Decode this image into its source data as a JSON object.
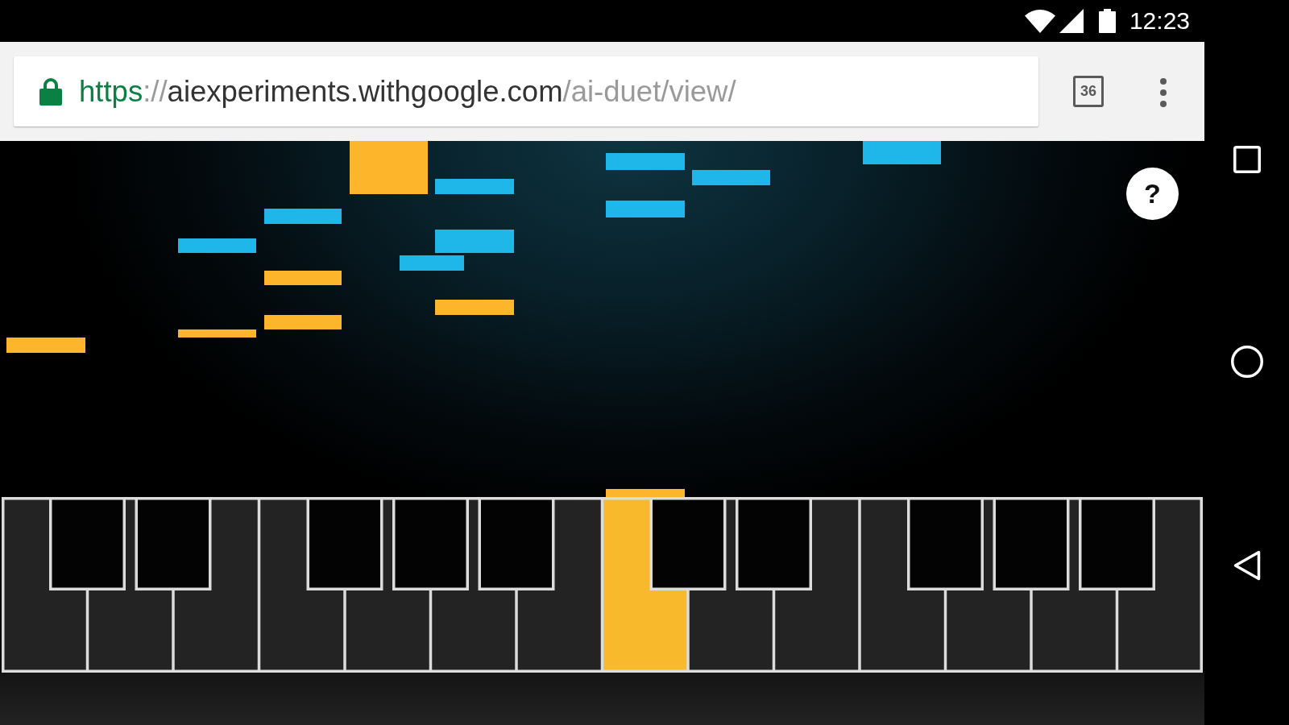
{
  "status_bar": {
    "time": "12:23"
  },
  "toolbar": {
    "url": {
      "scheme": "https",
      "separator": "://",
      "host": "aiexperiments.withgoogle.com",
      "path": "/ai-duet/view/"
    },
    "tab_count": "36"
  },
  "help_button": {
    "label": "?"
  },
  "keyboard": {
    "keys": [
      {
        "kind": "white",
        "pressed": false
      },
      {
        "kind": "black",
        "pressed": false
      },
      {
        "kind": "white",
        "pressed": false
      },
      {
        "kind": "black",
        "pressed": false
      },
      {
        "kind": "white",
        "pressed": false
      },
      {
        "kind": "white",
        "pressed": false
      },
      {
        "kind": "black",
        "pressed": false
      },
      {
        "kind": "white",
        "pressed": false
      },
      {
        "kind": "black",
        "pressed": false
      },
      {
        "kind": "white",
        "pressed": false
      },
      {
        "kind": "black",
        "pressed": false
      },
      {
        "kind": "white",
        "pressed": false
      },
      {
        "kind": "white",
        "pressed": true
      },
      {
        "kind": "black",
        "pressed": false
      },
      {
        "kind": "white",
        "pressed": false
      },
      {
        "kind": "black",
        "pressed": false
      },
      {
        "kind": "white",
        "pressed": false
      },
      {
        "kind": "white",
        "pressed": false
      },
      {
        "kind": "black",
        "pressed": false
      },
      {
        "kind": "white",
        "pressed": false
      },
      {
        "kind": "black",
        "pressed": false
      },
      {
        "kind": "white",
        "pressed": false
      },
      {
        "kind": "black",
        "pressed": false
      },
      {
        "kind": "white",
        "pressed": false
      }
    ]
  }
}
